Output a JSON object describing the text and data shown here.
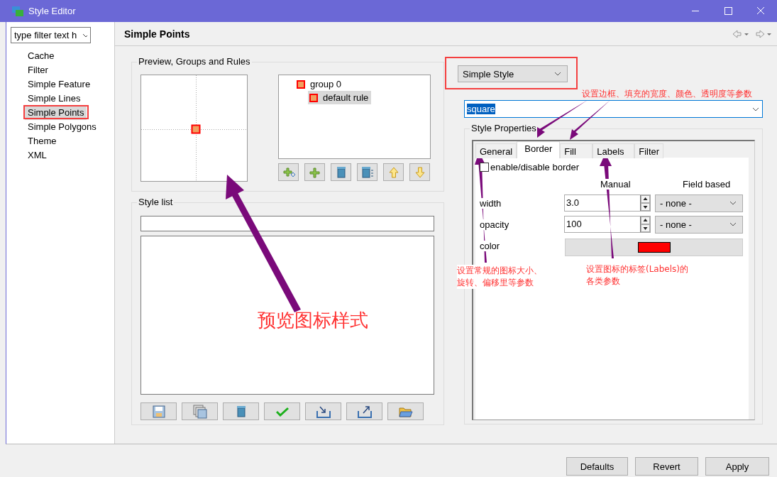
{
  "window": {
    "title": "Style Editor"
  },
  "sidebar": {
    "filter_placeholder": "type filter text h",
    "items": [
      {
        "label": "Cache",
        "selected": false
      },
      {
        "label": "Filter",
        "selected": false
      },
      {
        "label": "Simple Feature",
        "selected": false
      },
      {
        "label": "Simple Lines",
        "selected": false
      },
      {
        "label": "Simple Points",
        "selected": true
      },
      {
        "label": "Simple Polygons",
        "selected": false
      },
      {
        "label": "Theme",
        "selected": false
      },
      {
        "label": "XML",
        "selected": false
      }
    ]
  },
  "page": {
    "title": "Simple Points"
  },
  "preview_group": {
    "title": "Preview, Groups and Rules",
    "tree": [
      {
        "label": "group 0",
        "selected": false,
        "children": [
          {
            "label": "default rule",
            "selected": true
          }
        ]
      }
    ]
  },
  "style_list": {
    "title": "Style list"
  },
  "style_type": {
    "value": "Simple Style"
  },
  "mark": {
    "value": "square"
  },
  "style_properties": {
    "title": "Style Properties",
    "tabs": [
      {
        "label": "General",
        "selected": false
      },
      {
        "label": "Border",
        "selected": true
      },
      {
        "label": "Fill",
        "selected": false
      },
      {
        "label": "Labels",
        "selected": false
      },
      {
        "label": "Filter",
        "selected": false
      }
    ],
    "enable_checkbox": {
      "label": "enable/disable border",
      "checked": false
    },
    "headers": [
      "Manual",
      "Field based"
    ],
    "rows": [
      {
        "kind": "spinner",
        "label": "width",
        "value": "3.0",
        "field_based": "- none -"
      },
      {
        "kind": "spinner",
        "label": "opacity",
        "value": "100",
        "field_based": "- none -"
      },
      {
        "kind": "color",
        "label": "color"
      }
    ]
  },
  "buttons": [
    "Defaults",
    "Revert",
    "Apply"
  ],
  "annotations": [
    "设置边框、填充的宽度、颜色、透明度等参数",
    "设置常规的图标大小、旋转、偏移里等参数",
    "设置图标的标签(Labels)的各类参数",
    "预览图标样式"
  ]
}
